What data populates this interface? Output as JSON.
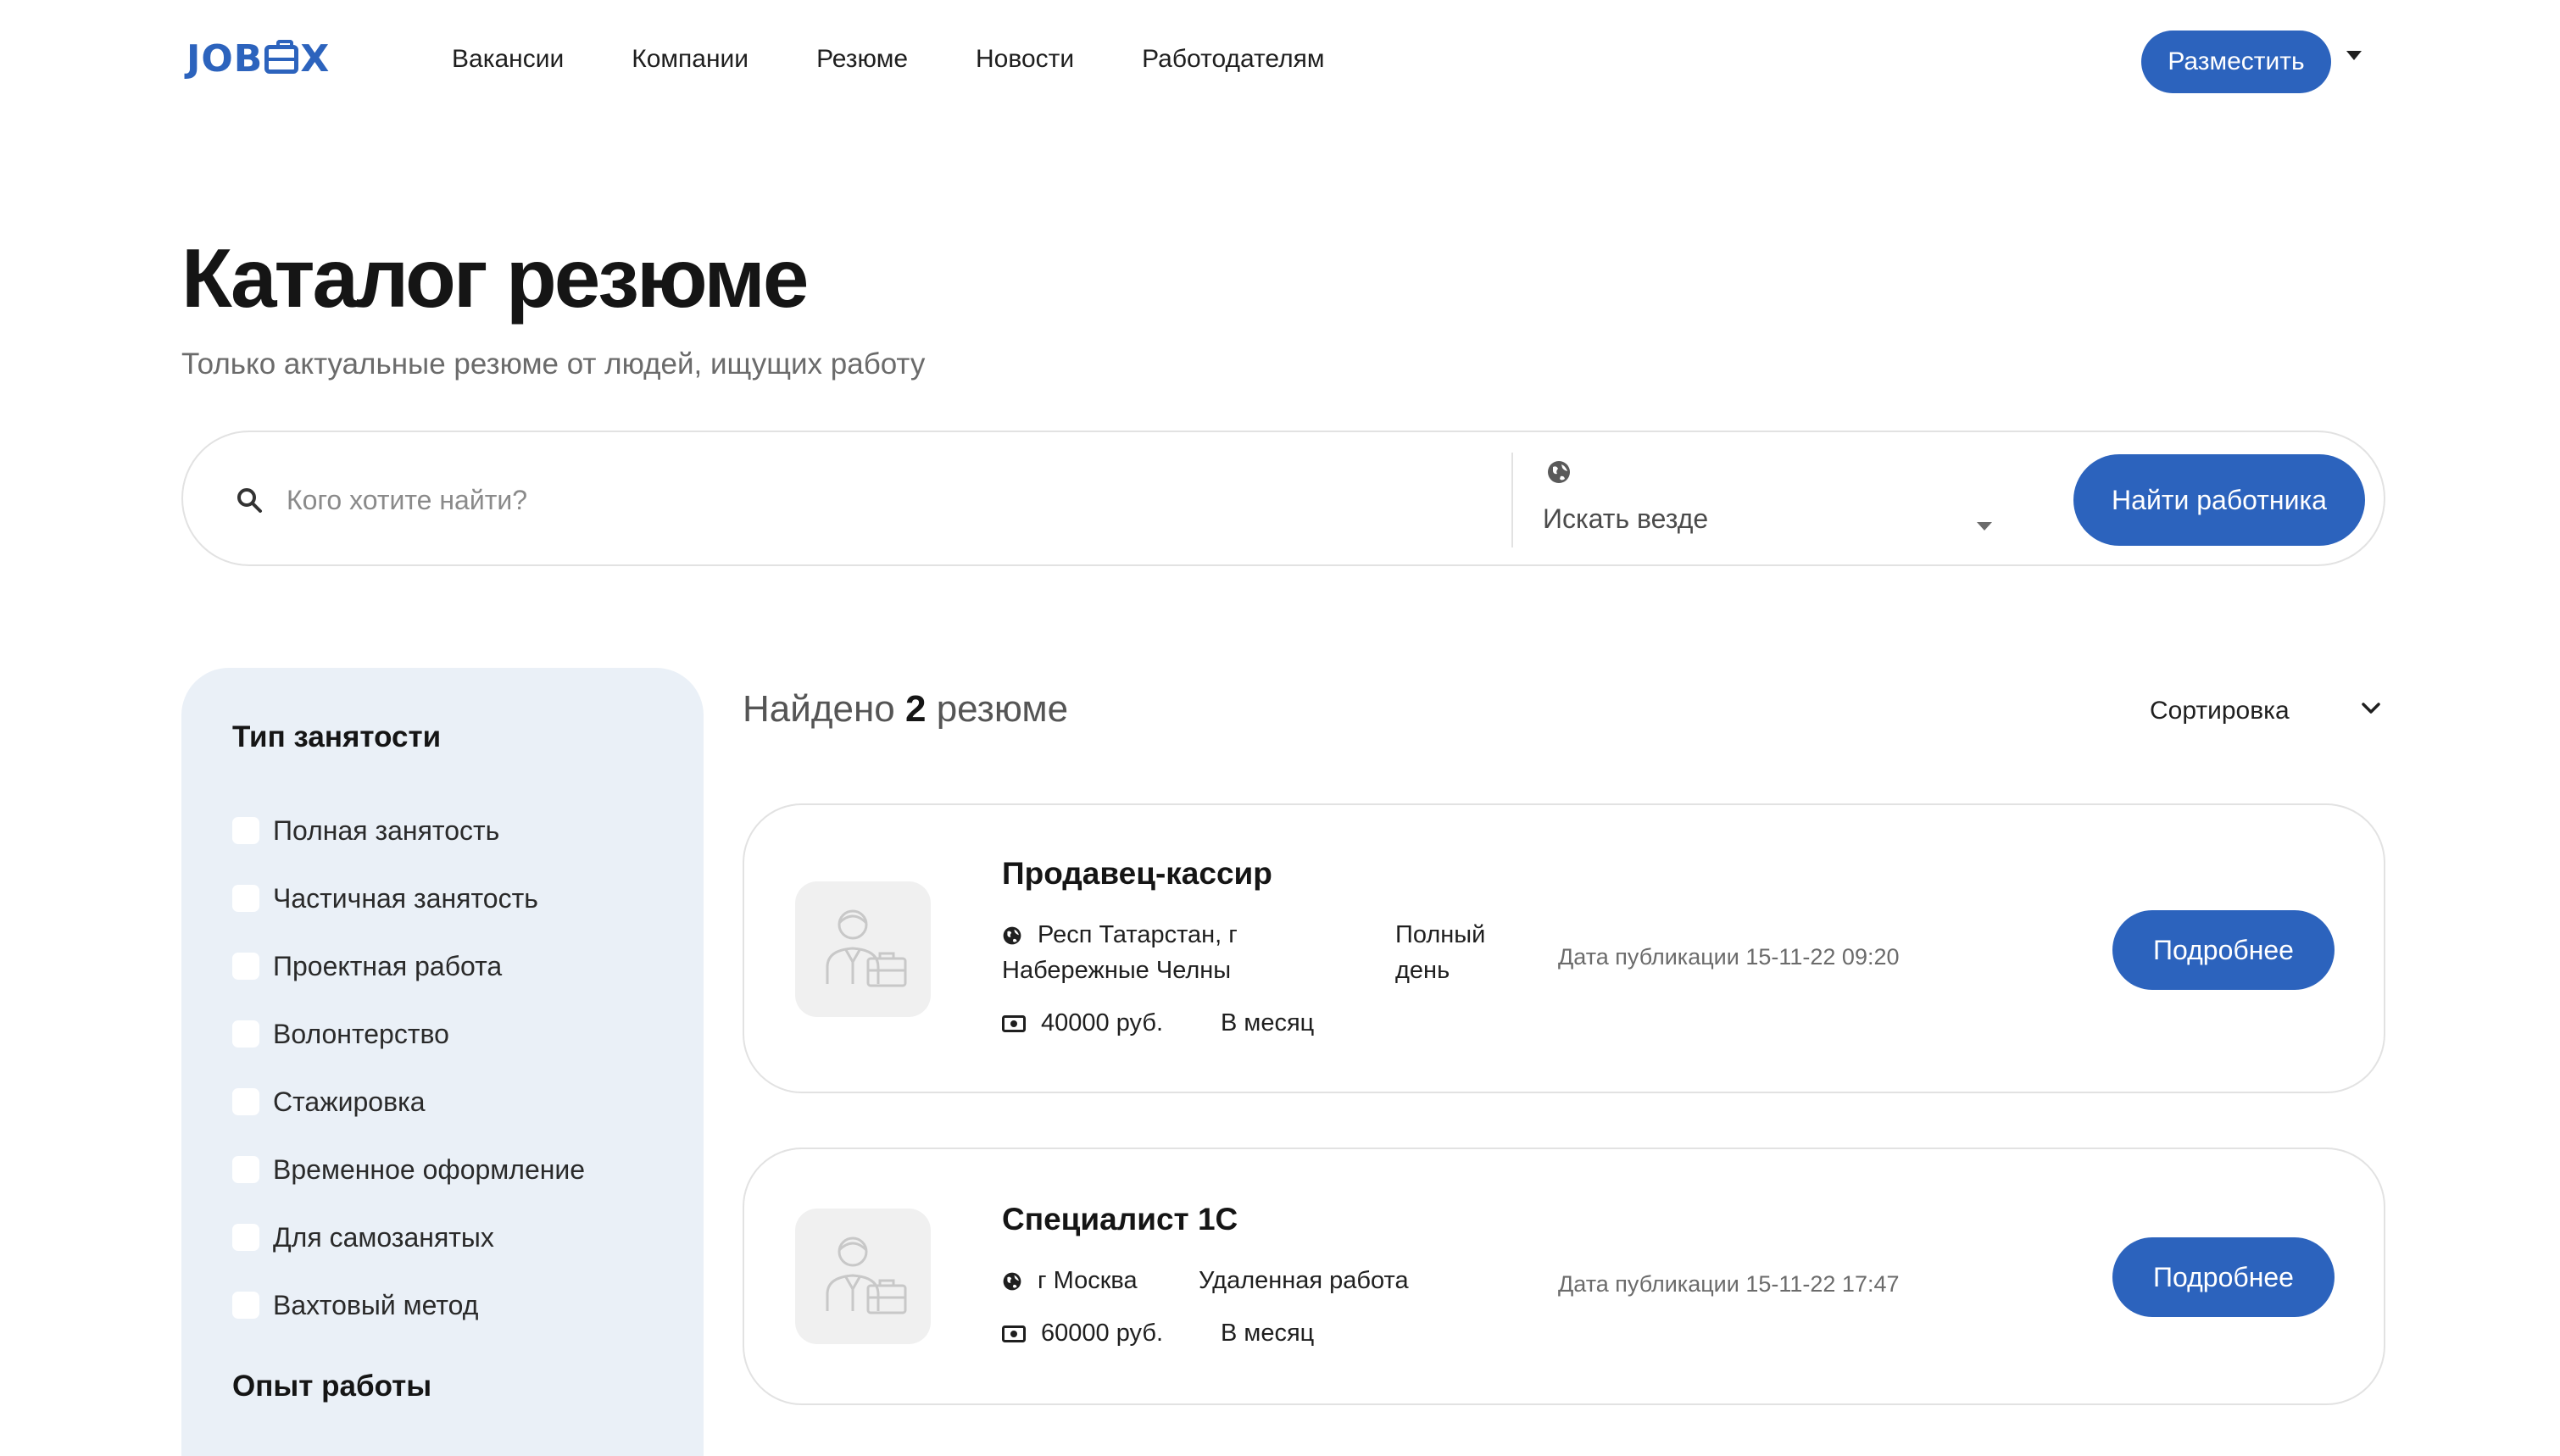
{
  "header": {
    "logo_text_left": "JOB",
    "logo_text_right": "X",
    "nav": [
      "Вакансии",
      "Компании",
      "Резюме",
      "Новости",
      "Работодателям"
    ],
    "post_button": "Разместить"
  },
  "hero": {
    "title": "Каталог резюме",
    "subtitle": "Только актуальные резюме от людей, ищущих работу"
  },
  "search": {
    "placeholder": "Кого хотите найти?",
    "location_value": "Искать везде",
    "button": "Найти работника"
  },
  "sidebar": {
    "employment_heading": "Тип занятости",
    "employment_types": [
      "Полная занятость",
      "Частичная занятость",
      "Проектная работа",
      "Волонтерство",
      "Стажировка",
      "Временное оформление",
      "Для самозанятых",
      "Вахтовый метод"
    ],
    "experience_heading": "Опыт работы"
  },
  "results": {
    "found_prefix": "Найдено",
    "found_count": "2",
    "found_suffix": "резюме",
    "sort_label": "Сортировка"
  },
  "resumes": [
    {
      "title": "Продавец-кассир",
      "location_line1": "Респ Татарстан, г",
      "location_line2": "Набережные Челны",
      "schedule_line1": "Полный",
      "schedule_line2": "день",
      "salary": "40000 руб.",
      "period": "В месяц",
      "published": "Дата публикации 15-11-22 09:20",
      "button": "Подробнее"
    },
    {
      "title": "Специалист 1С",
      "location_line1": "г Москва",
      "schedule_line1": "Удаленная работа",
      "salary": "60000 руб.",
      "period": "В месяц",
      "published": "Дата публикации 15-11-22 17:47",
      "button": "Подробнее"
    }
  ],
  "colors": {
    "accent": "#2c63bd",
    "sidebar_bg": "#eaf0f7",
    "border": "#e2e2e2"
  }
}
